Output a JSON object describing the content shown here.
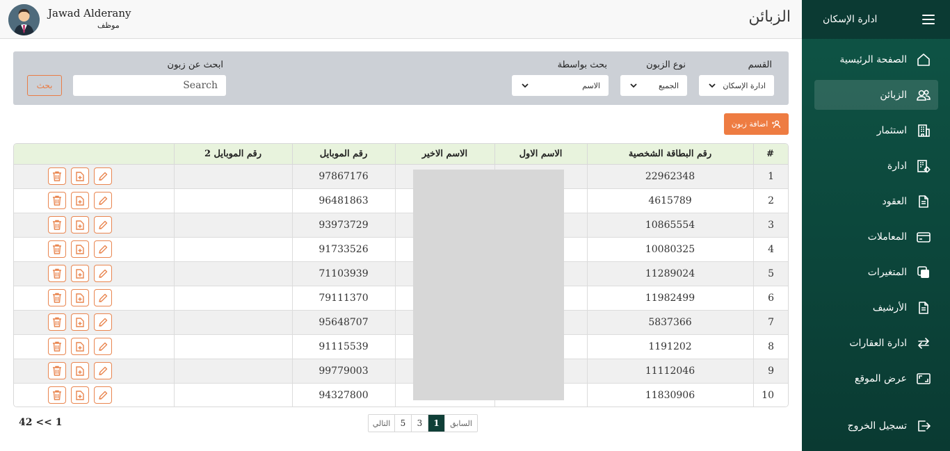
{
  "header": {
    "user_name": "Jawad Alderany",
    "user_role": "موظف",
    "page_title": "الزبائن"
  },
  "sidebar": {
    "title": "ادارة الإسكان",
    "items": [
      {
        "label": "الصفحة الرئيسية",
        "icon": "home-icon"
      },
      {
        "label": "الزبائن",
        "icon": "users-icon"
      },
      {
        "label": "استثمار",
        "icon": "building-icon"
      },
      {
        "label": "ادارة",
        "icon": "building-gear-icon"
      },
      {
        "label": "العقود",
        "icon": "document-icon"
      },
      {
        "label": "المعاملات",
        "icon": "card-icon"
      },
      {
        "label": "المتغيرات",
        "icon": "copy-icon"
      },
      {
        "label": "الأرشيف",
        "icon": "archive-file-icon"
      },
      {
        "label": "ادارة العقارات",
        "icon": "swap-arrows-icon"
      },
      {
        "label": "عرض الموقع",
        "icon": "screen-icon"
      }
    ],
    "active_index": 1,
    "logout_label": "تسجيل الخروج"
  },
  "filters": {
    "department_label": "القسم",
    "department_value": "ادارة الإسكان",
    "customer_type_label": "نوع الزبون",
    "customer_type_value": "الجميع",
    "search_by_label": "بحث بواسطة",
    "search_by_value": "الاسم",
    "search_label": "ابحث عن زبون",
    "search_placeholder": "Search",
    "search_button": "بحث"
  },
  "add_button": "اضافة زبون",
  "table": {
    "columns": [
      "#",
      "رقم البطاقة الشخصية",
      "الاسم الاول",
      "الاسم الاخير",
      "رقم الموبايل",
      "رقم الموبايل 2",
      ""
    ],
    "rows": [
      {
        "n": "1",
        "id_card": "22962348",
        "first": "",
        "last": "",
        "mobile": "97867176",
        "mobile2": ""
      },
      {
        "n": "2",
        "id_card": "4615789",
        "first": "",
        "last": "",
        "mobile": "96481863",
        "mobile2": ""
      },
      {
        "n": "3",
        "id_card": "10865554",
        "first": "",
        "last": "",
        "mobile": "93973729",
        "mobile2": ""
      },
      {
        "n": "4",
        "id_card": "10080325",
        "first": "",
        "last": "",
        "mobile": "91733526",
        "mobile2": ""
      },
      {
        "n": "5",
        "id_card": "11289024",
        "first": "",
        "last": "",
        "mobile": "71103939",
        "mobile2": ""
      },
      {
        "n": "6",
        "id_card": "11982499",
        "first": "",
        "last": "",
        "mobile": "79111370",
        "mobile2": ""
      },
      {
        "n": "7",
        "id_card": "5837366",
        "first": "",
        "last": "",
        "mobile": "95648707",
        "mobile2": ""
      },
      {
        "n": "8",
        "id_card": "1191202",
        "first": "",
        "last": "",
        "mobile": "91115539",
        "mobile2": ""
      },
      {
        "n": "9",
        "id_card": "11112046",
        "first": "",
        "last": "",
        "mobile": "99779003",
        "mobile2": ""
      },
      {
        "n": "10",
        "id_card": "11830906",
        "first": "",
        "last": "",
        "mobile": "94327800",
        "mobile2": ""
      }
    ]
  },
  "pagination": {
    "prev": "السابق",
    "pages": [
      "1",
      "3",
      "5"
    ],
    "current": "1",
    "next": "التالي",
    "info": "42 << 1"
  },
  "colors": {
    "sidebar": "#0f5546",
    "accent": "#ee7c42",
    "header_row": "#e8f3dd",
    "filter_panel": "#ccd0d6",
    "active_page": "#0f3f37"
  }
}
